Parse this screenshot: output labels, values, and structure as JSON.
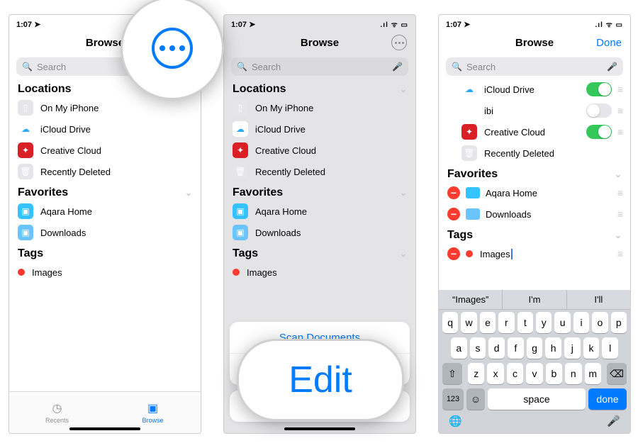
{
  "colors": {
    "blue": "#007aff",
    "green": "#34c759",
    "red": "#ff3b30",
    "grey": "#8e8e93"
  },
  "status": {
    "time": "1:07",
    "loc_glyph": "➤",
    "signal": "ıılı",
    "wifi": "✶",
    "battery": "■"
  },
  "nav": {
    "browse": "Browse",
    "done": "Done"
  },
  "search": {
    "placeholder": "Search"
  },
  "sections": {
    "locations": "Locations",
    "favorites": "Favorites",
    "tags": "Tags"
  },
  "p1": {
    "locations": [
      "On My iPhone",
      "iCloud Drive",
      "Creative Cloud",
      "Recently Deleted"
    ],
    "favorites": [
      "Aqara Home",
      "Downloads"
    ],
    "tags": [
      "Images"
    ]
  },
  "p2": {
    "locations": [
      "On My iPhone",
      "iCloud Drive",
      "Creative Cloud",
      "Recently Deleted"
    ],
    "favorites": [
      "Aqara Home",
      "Downloads"
    ],
    "tags": [
      "Images"
    ],
    "sheet": {
      "scan": "Scan Documents",
      "edit": "Edit",
      "cancel": ""
    }
  },
  "p3": {
    "locations": [
      {
        "label": "iCloud Drive",
        "on": true,
        "icon": "icloud"
      },
      {
        "label": "ibi",
        "on": false,
        "icon": "ibi"
      },
      {
        "label": "Creative Cloud",
        "on": true,
        "icon": "cc"
      },
      {
        "label": "Recently Deleted",
        "on": null,
        "icon": "trash"
      }
    ],
    "favorites": [
      "Aqara Home",
      "Downloads"
    ],
    "tags": [
      "Images"
    ]
  },
  "tabs": {
    "recents": "Recents",
    "browse": "Browse"
  },
  "keyboard": {
    "suggestions": [
      "“Images”",
      "I'm",
      "I'll"
    ],
    "r1": [
      "q",
      "w",
      "e",
      "r",
      "t",
      "y",
      "u",
      "i",
      "o",
      "p"
    ],
    "r2": [
      "a",
      "s",
      "d",
      "f",
      "g",
      "h",
      "j",
      "k",
      "l"
    ],
    "r3": [
      "z",
      "x",
      "c",
      "v",
      "b",
      "n",
      "m"
    ],
    "num": "123",
    "space": "space",
    "done": "done"
  },
  "callout": {
    "edit": "Edit"
  }
}
